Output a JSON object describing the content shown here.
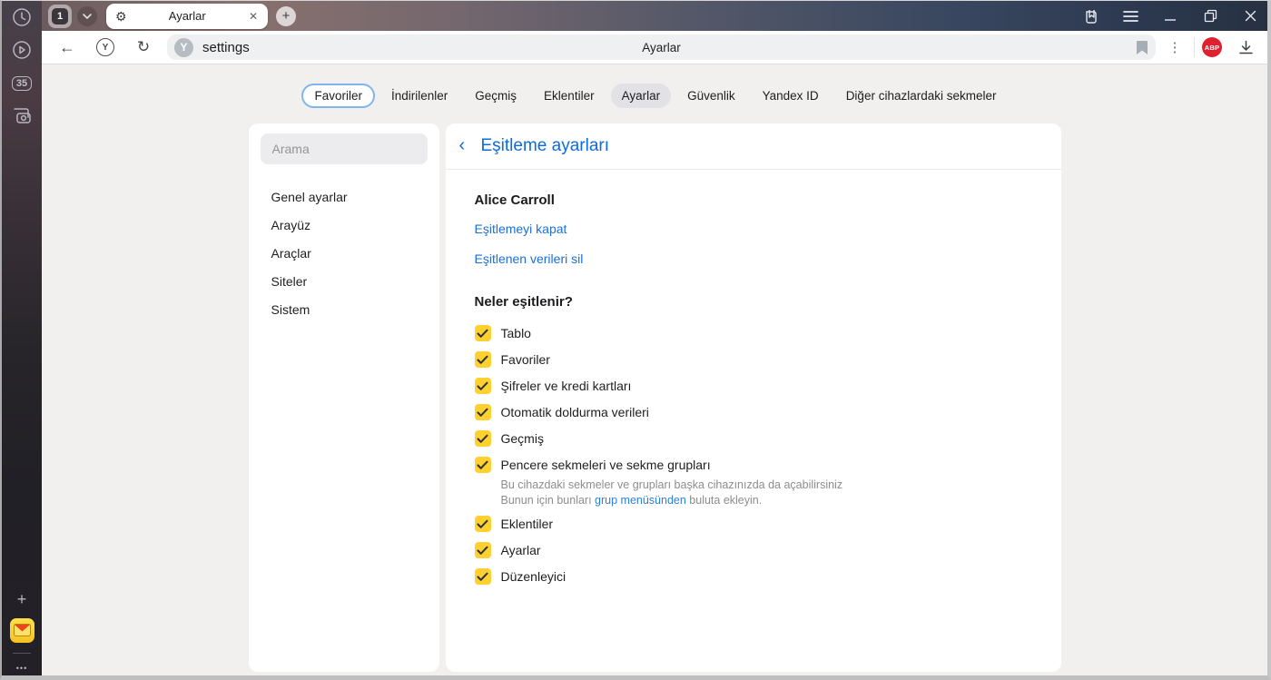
{
  "colors": {
    "accent_blue": "#0d6be0",
    "link_blue": "#1a6fdb",
    "checkbox_yellow": "#ffd12e",
    "abp_red": "#e01f2f",
    "favoriler_chip_border": "#7fb5ec"
  },
  "side_rail": {
    "tab_count": "35"
  },
  "tab_strip": {
    "group_count": "1",
    "tab_title": "Ayarlar"
  },
  "toolbar": {
    "url": "settings",
    "page_title": "Ayarlar",
    "abp_label": "ABP"
  },
  "icons": {
    "gear": "⚙",
    "close": "✕",
    "plus": "+",
    "new_tab_plus": "+",
    "back": "←",
    "reload": "↻",
    "dots_vertical": "⋮",
    "dots_horizontal": "•••",
    "back_chevron": "‹",
    "favicon_letter": "Y",
    "home_letter": "Y"
  },
  "nav_tabs": {
    "items": [
      {
        "label": "Favoriler"
      },
      {
        "label": "İndirilenler"
      },
      {
        "label": "Geçmiş"
      },
      {
        "label": "Eklentiler"
      },
      {
        "label": "Ayarlar"
      },
      {
        "label": "Güvenlik"
      },
      {
        "label": "Yandex ID"
      },
      {
        "label": "Diğer cihazlardaki sekmeler"
      }
    ]
  },
  "settings_nav": {
    "search_placeholder": "Arama",
    "items": [
      {
        "label": "Genel ayarlar"
      },
      {
        "label": "Arayüz"
      },
      {
        "label": "Araçlar"
      },
      {
        "label": "Siteler"
      },
      {
        "label": "Sistem"
      }
    ]
  },
  "main": {
    "title": "Eşitleme ayarları",
    "account_name": "Alice Carroll",
    "link_disable_sync": "Eşitlemeyi kapat",
    "link_delete_synced": "Eşitlenen verileri sil",
    "section_title": "Neler eşitlenir?",
    "sync_items": [
      {
        "label": "Tablo",
        "checked": true
      },
      {
        "label": "Favoriler",
        "checked": true
      },
      {
        "label": "Şifreler ve kredi kartları",
        "checked": true
      },
      {
        "label": "Otomatik doldurma verileri",
        "checked": true
      },
      {
        "label": "Geçmiş",
        "checked": true
      },
      {
        "label": "Pencere sekmeleri ve sekme grupları",
        "checked": true,
        "description_line1": "Bu cihazdaki sekmeler ve grupları başka cihazınızda da açabilirsiniz",
        "description_line2_prefix": "Bunun için bunları ",
        "description_line2_link": "grup menüsünden",
        "description_line2_suffix": " buluta ekleyin."
      },
      {
        "label": "Eklentiler",
        "checked": true
      },
      {
        "label": "Ayarlar",
        "checked": true
      },
      {
        "label": "Düzenleyici",
        "checked": true
      }
    ]
  }
}
